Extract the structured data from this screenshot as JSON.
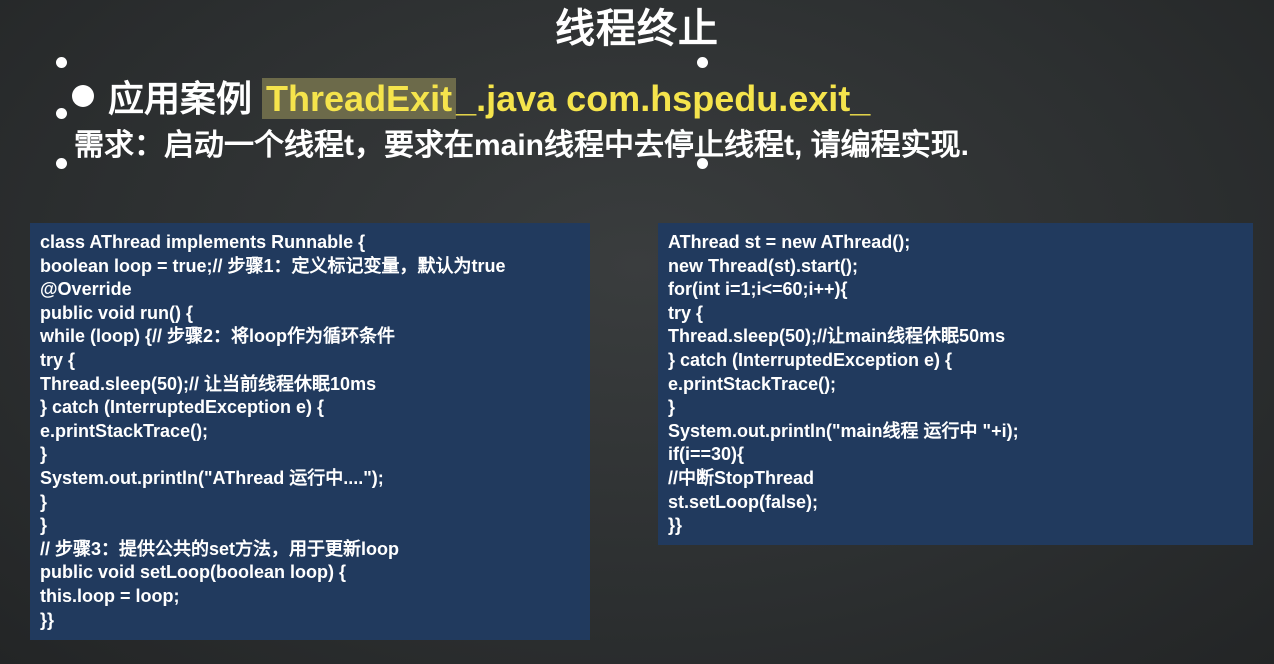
{
  "slide": {
    "title": "线程终止",
    "case_label": "应用案例",
    "class_name": "ThreadExit",
    "file_ext_pkg": "_.java com.hspedu.exit_",
    "requirement": "需求：启动一个线程t，要求在main线程中去停止线程t, 请编程实现."
  },
  "left_code": [
    "class AThread implements Runnable {",
    "boolean loop = true;// 步骤1：定义标记变量，默认为true",
    "@Override",
    "public void run() {",
    "while (loop) {// 步骤2：将loop作为循环条件",
    "try {",
    "Thread.sleep(50);// 让当前线程休眠10ms",
    "} catch (InterruptedException e) {",
    "e.printStackTrace();",
    "}",
    "System.out.println(\"AThread 运行中....\");",
    "}",
    "}",
    "// 步骤3：提供公共的set方法，用于更新loop",
    "public void setLoop(boolean loop) {",
    "this.loop = loop;",
    "}}"
  ],
  "right_code": [
    "AThread st = new AThread();",
    "new Thread(st).start();",
    "for(int i=1;i<=60;i++){",
    "try {",
    "Thread.sleep(50);//让main线程休眠50ms",
    "} catch (InterruptedException e) {",
    "e.printStackTrace();",
    "}",
    "System.out.println(\"main线程 运行中 \"+i);",
    "if(i==30){",
    "//中断StopThread",
    "st.setLoop(false);",
    "}}"
  ]
}
